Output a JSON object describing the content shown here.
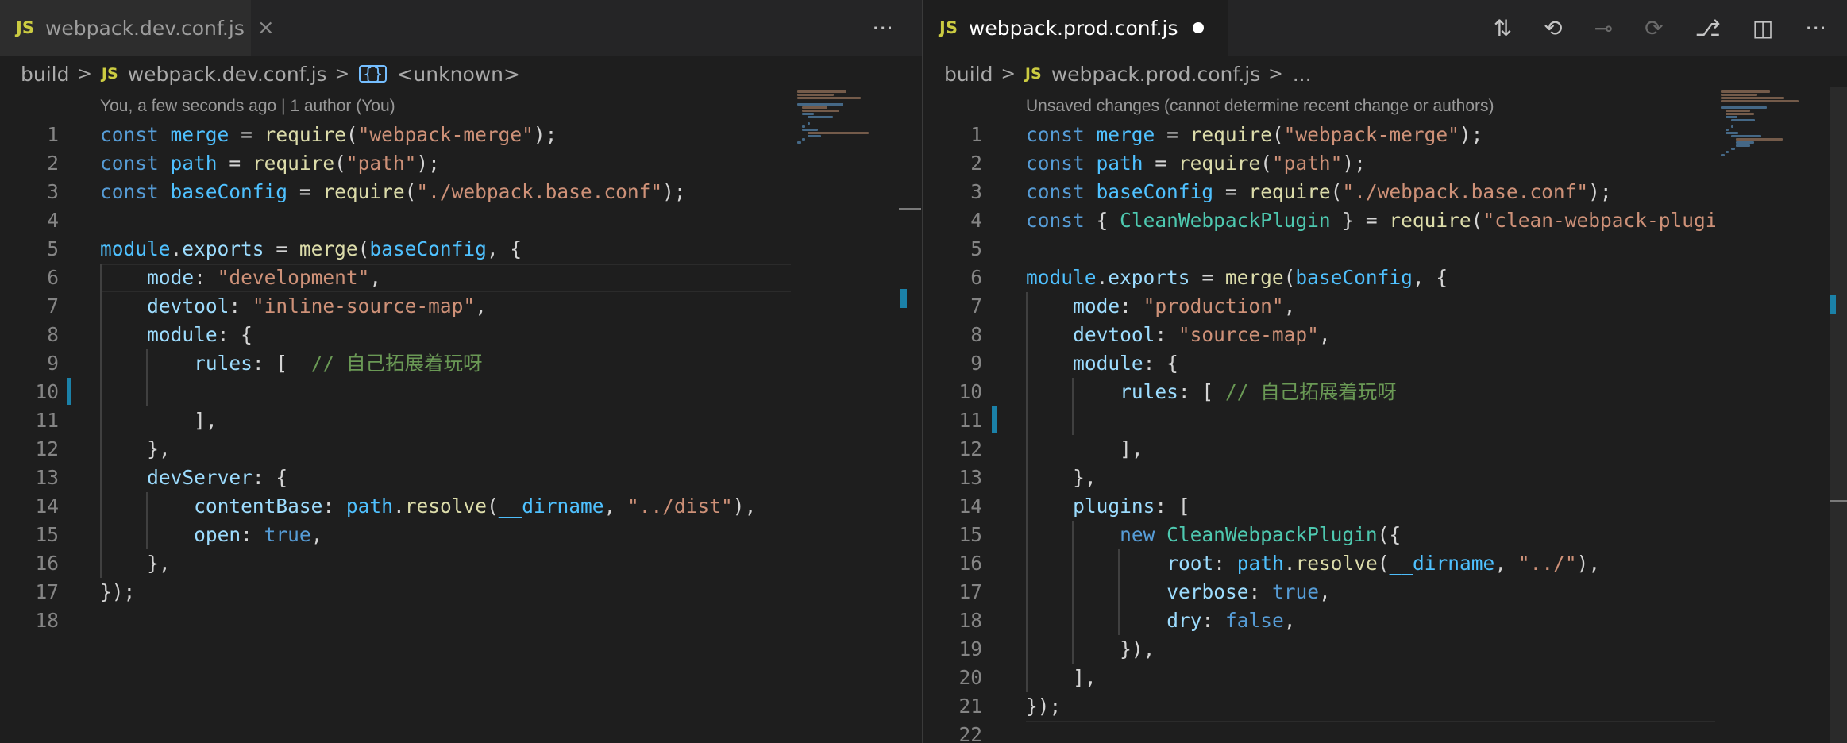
{
  "left": {
    "tab": {
      "badge": "JS",
      "title": "webpack.dev.conf.js",
      "close": "×"
    },
    "actions": {
      "more": "···"
    },
    "breadcrumb": {
      "folder": "build",
      "file_badge": "JS",
      "file": "webpack.dev.conf.js",
      "symbol_icon": "{}",
      "symbol": "<unknown>"
    },
    "codelens": "You, a few seconds ago | 1 author (You)",
    "lines": [
      {
        "n": "1",
        "t": "const merge = require(\"webpack-merge\");"
      },
      {
        "n": "2",
        "t": "const path = require(\"path\");"
      },
      {
        "n": "3",
        "t": "const baseConfig = require(\"./webpack.base.conf\");"
      },
      {
        "n": "4",
        "t": ""
      },
      {
        "n": "5",
        "t": "module.exports = merge(baseConfig, {"
      },
      {
        "n": "6",
        "t": "    mode: \"development\","
      },
      {
        "n": "7",
        "t": "    devtool: \"inline-source-map\","
      },
      {
        "n": "8",
        "t": "    module: {"
      },
      {
        "n": "9",
        "t": "        rules: [  // 自己拓展着玩呀"
      },
      {
        "n": "10",
        "t": ""
      },
      {
        "n": "11",
        "t": "        ],"
      },
      {
        "n": "12",
        "t": "    },"
      },
      {
        "n": "13",
        "t": "    devServer: {"
      },
      {
        "n": "14",
        "t": "        contentBase: path.resolve(__dirname, \"../dist\"),"
      },
      {
        "n": "15",
        "t": "        open: true,"
      },
      {
        "n": "16",
        "t": "    },"
      },
      {
        "n": "17",
        "t": "});"
      },
      {
        "n": "18",
        "t": ""
      }
    ]
  },
  "right": {
    "tab": {
      "badge": "JS",
      "title": "webpack.prod.conf.js"
    },
    "actions": {
      "open_changes": "⇅",
      "prev_change": "⟲",
      "commit": "⊸",
      "next_change": "⟳",
      "git_graph": "⎇",
      "split": "◫",
      "more": "···"
    },
    "breadcrumb": {
      "folder": "build",
      "file_badge": "JS",
      "file": "webpack.prod.conf.js",
      "ellipsis": "..."
    },
    "codelens": "Unsaved changes (cannot determine recent change or authors)",
    "lines": [
      {
        "n": "1",
        "t": "const merge = require(\"webpack-merge\");"
      },
      {
        "n": "2",
        "t": "const path = require(\"path\");"
      },
      {
        "n": "3",
        "t": "const baseConfig = require(\"./webpack.base.conf\");"
      },
      {
        "n": "4",
        "t": "const { CleanWebpackPlugin } = require(\"clean-webpack-plugin\""
      },
      {
        "n": "5",
        "t": ""
      },
      {
        "n": "6",
        "t": "module.exports = merge(baseConfig, {"
      },
      {
        "n": "7",
        "t": "    mode: \"production\","
      },
      {
        "n": "8",
        "t": "    devtool: \"source-map\","
      },
      {
        "n": "9",
        "t": "    module: {"
      },
      {
        "n": "10",
        "t": "        rules: [ // 自己拓展着玩呀"
      },
      {
        "n": "11",
        "t": ""
      },
      {
        "n": "12",
        "t": "        ],"
      },
      {
        "n": "13",
        "t": "    },"
      },
      {
        "n": "14",
        "t": "    plugins: ["
      },
      {
        "n": "15",
        "t": "        new CleanWebpackPlugin({"
      },
      {
        "n": "16",
        "t": "            root: path.resolve(__dirname, \"../\"),"
      },
      {
        "n": "17",
        "t": "            verbose: true,"
      },
      {
        "n": "18",
        "t": "            dry: false,"
      },
      {
        "n": "19",
        "t": "        }),"
      },
      {
        "n": "20",
        "t": "    ],"
      },
      {
        "n": "21",
        "t": "});"
      },
      {
        "n": "22",
        "t": ""
      }
    ]
  },
  "colors": {
    "keyword": "#569cd6",
    "variable": "#4fc1ff",
    "function": "#dcdcaa",
    "string": "#ce9178",
    "property": "#9cdcfe",
    "class": "#4ec9b0",
    "comment": "#6a9955",
    "gutter_modified": "#1b81a8"
  }
}
